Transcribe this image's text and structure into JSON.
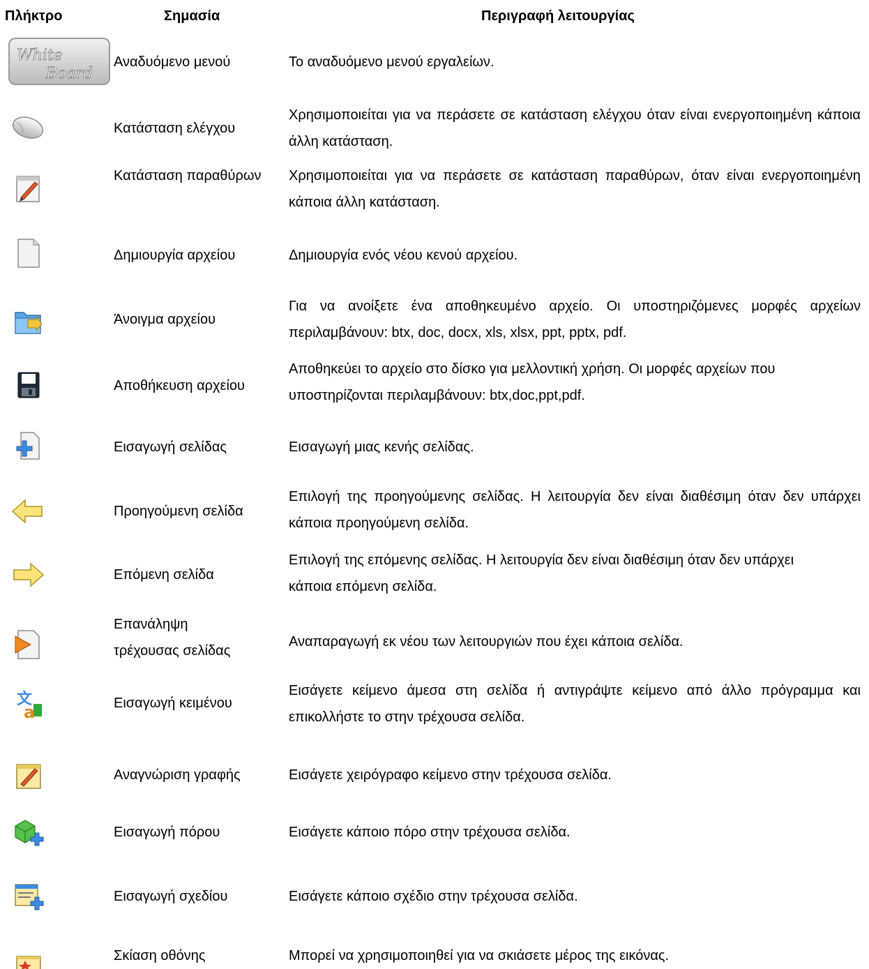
{
  "headers": {
    "key": "Πλήκτρο",
    "meaning": "Σημασία",
    "description": "Περιγραφή λειτουργίας"
  },
  "rows": [
    {
      "icon": "whiteboard-logo-button",
      "logo_text": "White Board",
      "meaning": "Αναδυόμενο μενού",
      "description": "Το αναδυόμενο μενού εργαλείων."
    },
    {
      "icon": "mouse-icon",
      "meaning": "Κατάσταση ελέγχου",
      "description": "Χρησιμοποιείται για να περάσετε σε κατάσταση ελέγχου όταν είναι ενεργοποιημένη κάποια άλλη κατάσταση."
    },
    {
      "icon": "window-pen-icon",
      "meaning": "Κατάσταση παραθύρων",
      "description": "Χρησιμοποιείται για να περάσετε σε κατάσταση παραθύρων, όταν είναι ενεργοποιημένη κάποια άλλη κατάσταση."
    },
    {
      "icon": "new-file-icon",
      "meaning": "Δημιουργία αρχείου",
      "description": "Δημιουργία ενός νέου κενού αρχείου."
    },
    {
      "icon": "open-folder-icon",
      "meaning": "Άνοιγμα αρχείου",
      "description": "Για να ανοίξετε ένα αποθηκευμένο αρχείο. Οι υποστηριζόμενες μορφές αρχείων περιλαμβάνουν: btx, doc, docx, xls, xlsx, ppt, pptx, pdf."
    },
    {
      "icon": "save-floppy-icon",
      "meaning": "Αποθήκευση αρχείου",
      "description": "Αποθηκεύει το αρχείο στο δίσκο για μελλοντική χρήση. Οι μορφές αρχείων που υποστηρίζονται περιλαμβάνουν:    btx,doc,ppt,pdf."
    },
    {
      "icon": "insert-page-icon",
      "meaning": "Εισαγωγή σελίδας",
      "description": "Εισαγωγή μιας κενής σελίδας."
    },
    {
      "icon": "previous-arrow-icon",
      "meaning": "Προηγούμενη σελίδα",
      "description": "Επιλογή της προηγούμενης σελίδας. Η λειτουργία δεν είναι διαθέσιμη όταν δεν υπάρχει κάποια προηγούμενη σελίδα."
    },
    {
      "icon": "next-arrow-icon",
      "meaning": "Επόμενη σελίδα",
      "description": "Επιλογή της επόμενης σελίδας. Η λειτουργία δεν είναι διαθέσιμη όταν δεν υπάρχει κάποια επόμενη σελίδα."
    },
    {
      "icon": "replay-page-icon",
      "meaning": "Επανάληψη τρέχουσας σελίδας",
      "description": "Αναπαραγωγή εκ νέου των λειτουργιών που έχει κάποια σελίδα."
    },
    {
      "icon": "insert-text-icon",
      "meaning": "Εισαγωγή κειμένου",
      "description": "Εισάγετε κείμενο άμεσα στη σελίδα ή αντιγράψτε κείμενο από άλλο πρόγραμμα και επικολλήστε το στην τρέχουσα σελίδα."
    },
    {
      "icon": "handwriting-icon",
      "meaning": "Αναγνώριση γραφής",
      "description": "Εισάγετε χειρόγραφο κείμενο στην τρέχουσα σελίδα."
    },
    {
      "icon": "insert-resource-icon",
      "meaning": "Εισαγωγή πόρου",
      "description": "Εισάγετε κάποιο πόρο στην τρέχουσα σελίδα."
    },
    {
      "icon": "insert-design-icon",
      "meaning": "Εισαγωγή σχεδίου",
      "description": "Εισάγετε κάποιο σχέδιο στην τρέχουσα σελίδα."
    },
    {
      "icon": "screen-shade-icon",
      "meaning": "Σκίαση οθόνης",
      "description": "Μπορεί να χρησιμοποιηθεί για να σκιάσετε μέρος της εικόνας."
    }
  ]
}
